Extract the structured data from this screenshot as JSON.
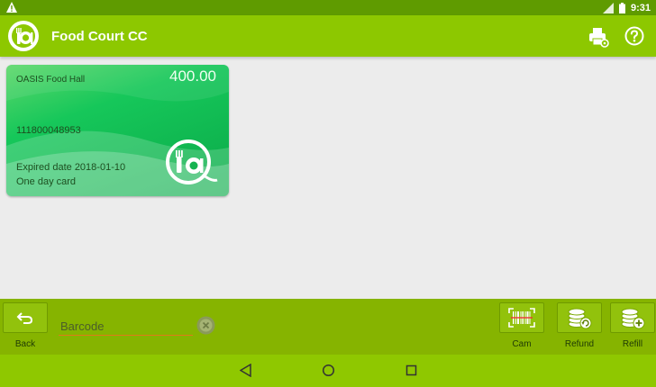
{
  "status_bar": {
    "time": "9:31",
    "icons": [
      "warning-icon",
      "signal-icon",
      "battery-icon"
    ]
  },
  "app_bar": {
    "title": "Food Court CC",
    "icons": [
      "printer-icon",
      "help-icon"
    ]
  },
  "card": {
    "name": "OASIS Food Hall",
    "amount": "400.00",
    "number": "111800048953",
    "expired": "Expired date 2018-01-10",
    "type": "One day card"
  },
  "toolbar": {
    "back_label": "Back",
    "barcode_placeholder": "Barcode",
    "cam_label": "Cam",
    "refund_label": "Refund",
    "refill_label": "Refill"
  },
  "colors": {
    "accent": "#8dc800",
    "status_bar": "#5f9b00",
    "card_green": "#16c75a",
    "underline": "#e07a1a"
  }
}
